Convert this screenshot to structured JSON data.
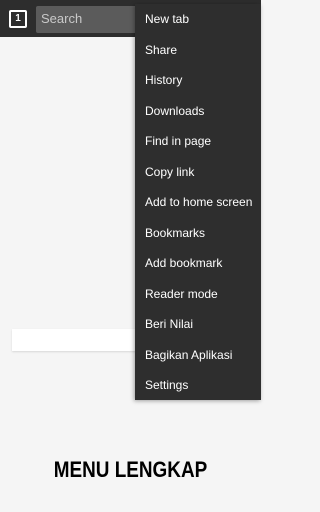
{
  "toolbar": {
    "tab_count": "1",
    "search_placeholder": "Search"
  },
  "menu": {
    "items": [
      {
        "label": "New tab"
      },
      {
        "label": "Share"
      },
      {
        "label": "History"
      },
      {
        "label": "Downloads"
      },
      {
        "label": "Find in page"
      },
      {
        "label": "Copy link"
      },
      {
        "label": "Add to home screen"
      },
      {
        "label": "Bookmarks"
      },
      {
        "label": "Add bookmark"
      },
      {
        "label": "Reader mode"
      },
      {
        "label": "Beri Nilai"
      },
      {
        "label": "Bagikan Aplikasi"
      },
      {
        "label": "Settings"
      }
    ]
  },
  "footer": {
    "title": "MENU LENGKAP"
  },
  "colors": {
    "toolbar_bg": "#2d2d2d",
    "menu_bg": "#2e2e2e",
    "page_bg": "#f5f5f5"
  }
}
